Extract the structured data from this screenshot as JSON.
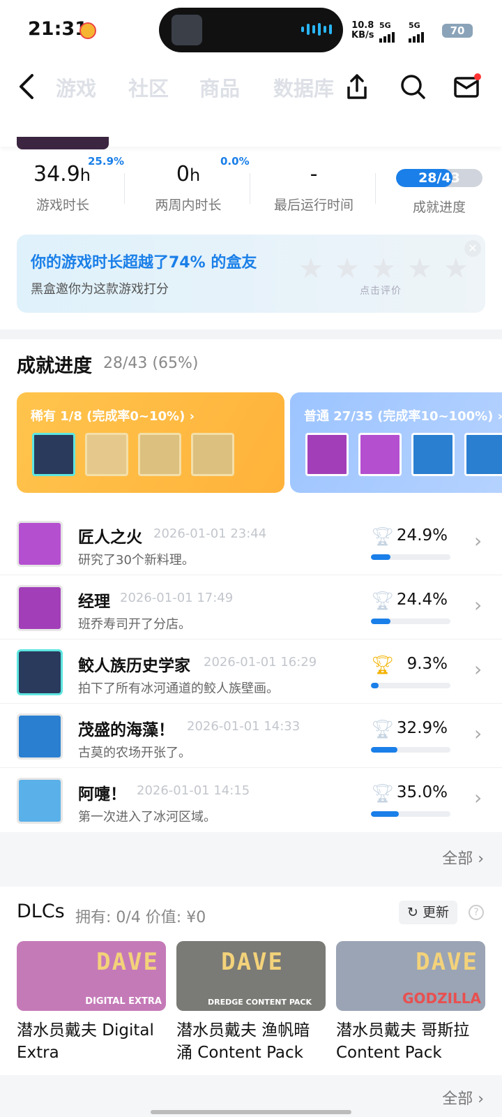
{
  "status_bar": {
    "time": "21:31",
    "net_speed_top": "10.8",
    "net_speed_unit": "KB/s",
    "signal_1": "5G",
    "signal_2": "5G",
    "battery": "70"
  },
  "nav": {
    "tabs": [
      "游戏",
      "社区",
      "商品",
      "数据库"
    ]
  },
  "stats": [
    {
      "value": "34.9",
      "unit": "h",
      "sup": "25.9%",
      "label": "游戏时长"
    },
    {
      "value": "0",
      "unit": "h",
      "sup": "0.0%",
      "label": "两周内时长"
    },
    {
      "value": "-",
      "unit": "",
      "sup": "",
      "label": "最后运行时间"
    },
    {
      "value": "28/43",
      "unit": "",
      "sup": "",
      "label": "成就进度",
      "fraction": 0.651
    }
  ],
  "rating": {
    "title": "你的游戏时长超越了74% 的盒友",
    "subtitle": "黑盒邀你为这款游戏打分",
    "hint": "点击评价",
    "stars": 5
  },
  "achievements": {
    "title": "成就进度",
    "summary": "28/43 (65%)",
    "rare_label": "稀有 1/8 (完成率0~10%) ›",
    "common_label": "普通 27/35 (完成率10~100%) ›",
    "items": [
      {
        "name": "匠人之火",
        "date": "2026-01-01 23:44",
        "desc": "研究了30个新料理。",
        "pct": "24.9%",
        "value": 24.9,
        "gold": false,
        "color": "#b44fd0"
      },
      {
        "name": "经理",
        "date": "2026-01-01 17:49",
        "desc": "班乔寿司开了分店。",
        "pct": "24.4%",
        "value": 24.4,
        "gold": false,
        "color": "#a23fb8"
      },
      {
        "name": "鲛人族历史学家",
        "date": "2026-01-01 16:29",
        "desc": "拍下了所有冰河通道的鲛人族壁画。",
        "pct": "9.3%",
        "value": 9.3,
        "gold": true,
        "color": "#2a3a5c"
      },
      {
        "name": "茂盛的海藻！",
        "date": "2026-01-01 14:33",
        "desc": "古莫的农场开张了。",
        "pct": "32.9%",
        "value": 32.9,
        "gold": false,
        "color": "#2a7fd0"
      },
      {
        "name": "阿嚏！",
        "date": "2026-01-01 14:15",
        "desc": "第一次进入了冰河区域。",
        "pct": "35.0%",
        "value": 35.0,
        "gold": false,
        "color": "#5ab0e8"
      }
    ],
    "all_label": "全部"
  },
  "dlcs": {
    "title": "DLCs",
    "summary": "拥有: 0/4 价值: ¥0",
    "update_label": "更新",
    "items": [
      {
        "name": "潜水员戴夫 Digital Extra",
        "logo": "DAVE",
        "band": "DIGITAL EXTRA",
        "bg": "#c57ab8"
      },
      {
        "name": "潜水员戴夫 渔帆暗涌 Content Pack",
        "logo": "DAVE",
        "band": "DREDGE CONTENT PACK",
        "bg": "#7a7a76"
      },
      {
        "name": "潜水员戴夫 哥斯拉 Content Pack",
        "logo": "DAVE",
        "band": "GODZILLA",
        "bg": "#9aa4b4"
      }
    ],
    "all_label": "全部"
  }
}
